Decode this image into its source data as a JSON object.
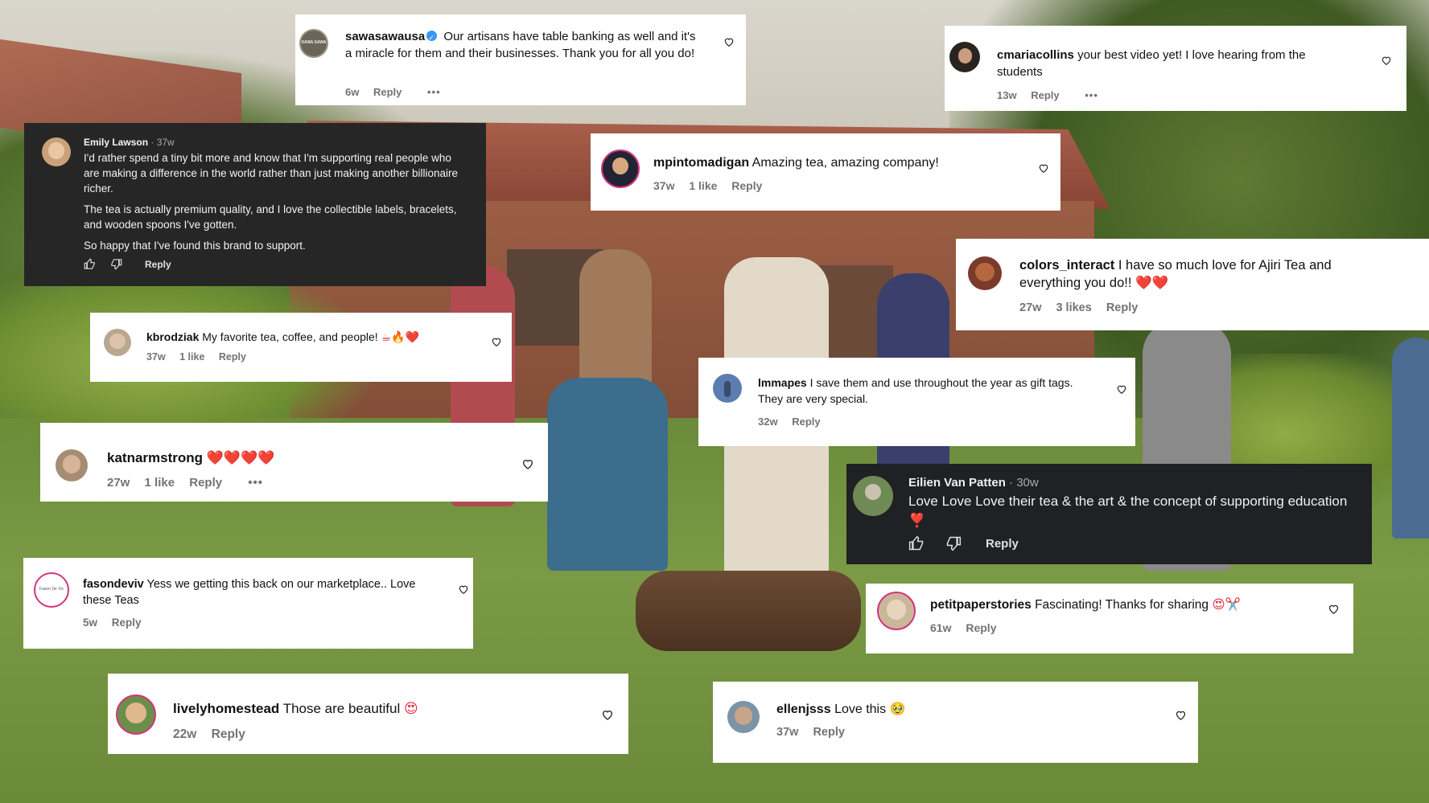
{
  "comments": {
    "sawasawausa": {
      "username": "sawasawausa",
      "text": "Our artisans have table banking as well and it's a miracle for them and their businesses. Thank you for all you do!",
      "avatar_text": "SAWA SAWA",
      "age": "6w",
      "reply": "Reply",
      "more": "•••"
    },
    "cmariacollins": {
      "username": "cmariacollins",
      "text": "your best video yet! I love hearing from the students",
      "age": "13w",
      "reply": "Reply",
      "more": "•••"
    },
    "emily_lawson": {
      "username": "Emily Lawson",
      "age": "· 37w",
      "paragraph1": "I'd rather spend a tiny bit more and know that I'm supporting real people who are making a difference in the world rather than just making another billionaire richer.",
      "paragraph2": "The tea is actually premium quality, and I love the collectible labels, bracelets, and wooden spoons I've gotten.",
      "paragraph3": "So happy that I've found this brand to support.",
      "reply": "Reply"
    },
    "mpintomadigan": {
      "username": "mpintomadigan",
      "text": "Amazing tea, amazing company!",
      "age": "37w",
      "likes": "1 like",
      "reply": "Reply"
    },
    "colors_interact": {
      "username": "colors_interact",
      "text": "I have so much love for Ajiri Tea and everything you do!!",
      "emoji": "❤️❤️",
      "age": "27w",
      "likes": "3 likes",
      "reply": "Reply"
    },
    "kbrodziak": {
      "username": "kbrodziak",
      "text": "My favorite tea, coffee, and people!",
      "emoji": "☕🔥❤️",
      "age": "37w",
      "likes": "1 like",
      "reply": "Reply"
    },
    "lmmapes": {
      "username": "lmmapes",
      "text": "I save them and use throughout the year as gift tags. They are very special.",
      "age": "32w",
      "reply": "Reply"
    },
    "katnarmstrong": {
      "username": "katnarmstrong",
      "emoji": "❤️❤️❤️❤️",
      "age": "27w",
      "likes": "1 like",
      "reply": "Reply",
      "more": "•••"
    },
    "eilien": {
      "username": "Eilien Van Patten",
      "age": "· 30w",
      "text": "Love Love Love their tea & the art & the concept of supporting education",
      "emoji": "❣️",
      "reply": "Reply"
    },
    "fasondeviv": {
      "username": "fasondeviv",
      "text": "Yess we getting this back on our marketplace.. Love these Teas",
      "avatar_text": "Fason De Viv",
      "age": "5w",
      "reply": "Reply"
    },
    "petitpaperstories": {
      "username": "petitpaperstories",
      "text": "Fascinating! Thanks for sharing",
      "emoji": "😍✂️",
      "age": "61w",
      "reply": "Reply"
    },
    "livelyhomestead": {
      "username": "livelyhomestead",
      "text": "Those are beautiful",
      "emoji": "😍",
      "age": "22w",
      "reply": "Reply"
    },
    "ellenjsss": {
      "username": "ellenjsss",
      "text": "Love this",
      "emoji": "🥹",
      "age": "37w",
      "reply": "Reply"
    }
  },
  "icons": [
    "heart-icon",
    "verified-icon",
    "more-icon",
    "thumbs-up-icon",
    "thumbs-down-icon"
  ],
  "colors": {
    "card": "#ffffff",
    "dark_card": "#262626",
    "meta": "#737373",
    "verified": "#3897f0",
    "heart_red": "#e8283a"
  }
}
